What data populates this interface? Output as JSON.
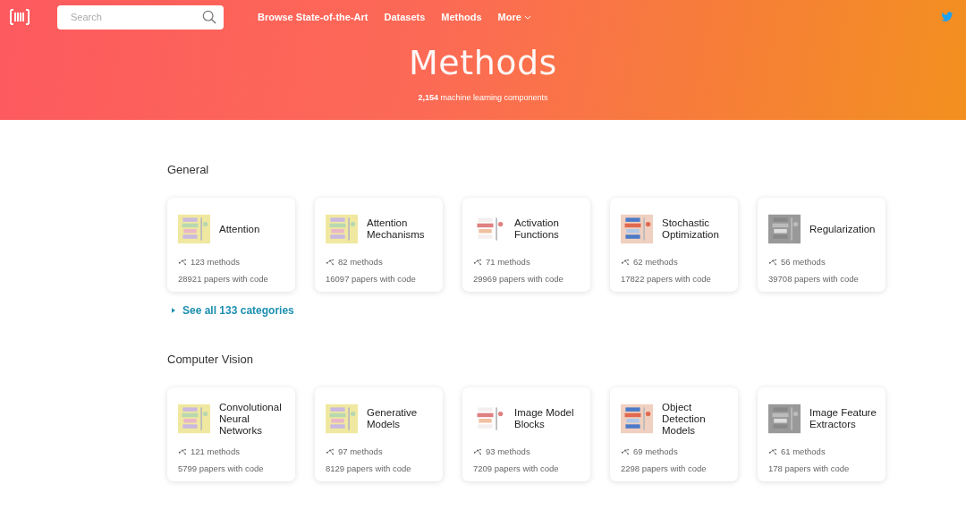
{
  "nav": {
    "search": {
      "placeholder": "Search"
    },
    "links": [
      "Browse State-of-the-Art",
      "Datasets",
      "Methods"
    ],
    "more": "More"
  },
  "hero": {
    "title": "Methods",
    "subtitle": "**2,154** machine learning components"
  },
  "sections": [
    {
      "title": "General",
      "cards": [
        {
          "name": "Attention",
          "methods": "123 methods",
          "papers": "28921 papers with code"
        },
        {
          "name": "Attention Mechanisms",
          "methods": "82 methods",
          "papers": "16097 papers with code"
        },
        {
          "name": "Activation Functions",
          "methods": "71 methods",
          "papers": "29969 papers with code"
        },
        {
          "name": "Stochastic Optimization",
          "methods": "62 methods",
          "papers": "17822 papers with code"
        },
        {
          "name": "Regularization",
          "methods": "56 methods",
          "papers": "39708 papers with code"
        }
      ],
      "see_all": "See all 133 categories"
    },
    {
      "title": "Computer Vision",
      "cards": [
        {
          "name": "Convolutional Neural Networks",
          "methods": "121 methods",
          "papers": "5799 papers with code"
        },
        {
          "name": "Generative Models",
          "methods": "97 methods",
          "papers": "8129 papers with code"
        },
        {
          "name": "Image Model Blocks",
          "methods": "93 methods",
          "papers": "7209 papers with code"
        },
        {
          "name": "Object Detection Models",
          "methods": "69 methods",
          "papers": "2298 papers with code"
        },
        {
          "name": "Image Feature Extractors",
          "methods": "61 methods",
          "papers": "178 papers with code"
        }
      ]
    }
  ]
}
